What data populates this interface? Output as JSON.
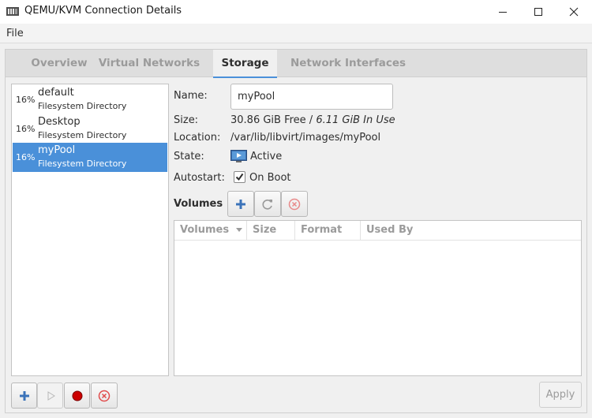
{
  "window": {
    "title": "QEMU/KVM Connection Details",
    "controls": {
      "minimize_icon": "minimize-icon",
      "maximize_icon": "maximize-icon",
      "close_icon": "close-icon"
    }
  },
  "menubar": {
    "file": "File"
  },
  "tabs": [
    {
      "label": "Overview",
      "active": false
    },
    {
      "label": "Virtual Networks",
      "active": false
    },
    {
      "label": "Storage",
      "active": true
    },
    {
      "label": "Network Interfaces",
      "active": false
    }
  ],
  "pools": [
    {
      "percent": "16%",
      "name": "default",
      "type": "Filesystem Directory",
      "selected": false
    },
    {
      "percent": "16%",
      "name": "Desktop",
      "type": "Filesystem Directory",
      "selected": false
    },
    {
      "percent": "16%",
      "name": "myPool",
      "type": "Filesystem Directory",
      "selected": true
    }
  ],
  "details": {
    "name_label": "Name:",
    "name_value": "myPool",
    "size_label": "Size:",
    "size_free": "30.86 GiB Free / ",
    "size_inuse": "6.11 GiB In Use",
    "location_label": "Location:",
    "location_value": "/var/lib/libvirt/images/myPool",
    "state_label": "State:",
    "state_value": "Active",
    "autostart_label": "Autostart:",
    "autostart_value": "On Boot",
    "autostart_checked": true
  },
  "volumes": {
    "title": "Volumes",
    "columns": [
      "Volumes",
      "Size",
      "Format",
      "Used By"
    ],
    "rows": []
  },
  "buttons": {
    "apply": "Apply"
  },
  "colors": {
    "accent": "#4a90d9",
    "delete_red": "#e04b4b",
    "record_red": "#cc0000"
  }
}
